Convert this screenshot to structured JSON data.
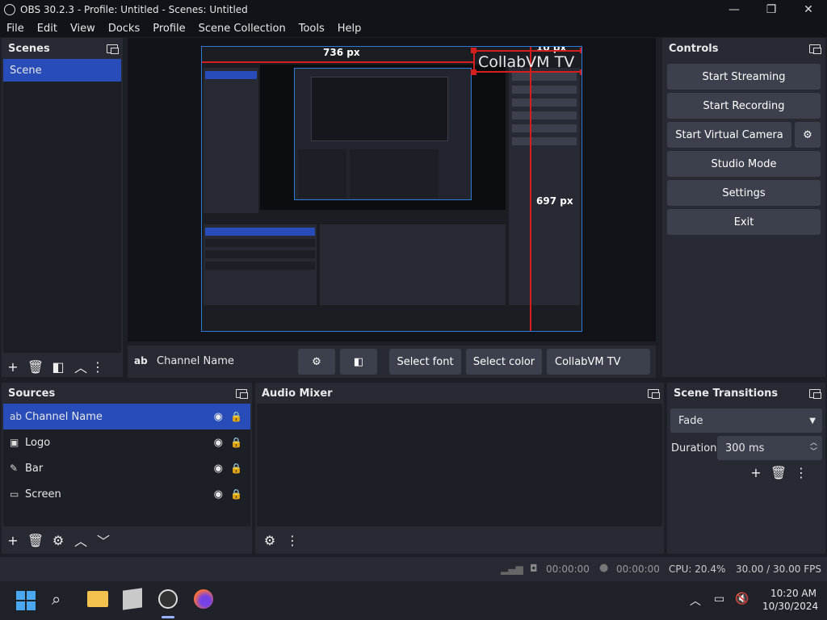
{
  "window": {
    "title": "OBS 30.2.3 - Profile: Untitled - Scenes: Untitled",
    "min": "—",
    "max": "❐",
    "close": "✕"
  },
  "menu": [
    "File",
    "Edit",
    "View",
    "Docks",
    "Profile",
    "Scene Collection",
    "Tools",
    "Help"
  ],
  "scenes": {
    "title": "Scenes",
    "items": [
      "Scene"
    ]
  },
  "controls": {
    "title": "Controls",
    "start_streaming": "Start Streaming",
    "start_recording": "Start Recording",
    "start_virtual_camera": "Start Virtual Camera",
    "studio_mode": "Studio Mode",
    "settings": "Settings",
    "exit": "Exit"
  },
  "preview": {
    "dim_top": "736 px",
    "dim_right_top": "10 px",
    "dim_right": "697 px",
    "overlay_text": "CollabVM TV",
    "border_color": "#2d7bd6",
    "guide_color": "#d41f1f"
  },
  "source_toolbar": {
    "type_icon": "ab",
    "name": "Channel Name",
    "select_font": "Select font",
    "select_color": "Select color",
    "text_value": "CollabVM TV"
  },
  "sources": {
    "title": "Sources",
    "items": [
      {
        "icon": "text-icon",
        "glyph": "ab",
        "name": "Channel Name"
      },
      {
        "icon": "image-icon",
        "glyph": "▣",
        "name": "Logo"
      },
      {
        "icon": "brush-icon",
        "glyph": "✎",
        "name": "Bar"
      },
      {
        "icon": "monitor-icon",
        "glyph": "▭",
        "name": "Screen"
      }
    ]
  },
  "audio_mixer": {
    "title": "Audio Mixer"
  },
  "transitions": {
    "title": "Scene Transitions",
    "selected": "Fade",
    "duration_label": "Duration",
    "duration_value": "300 ms"
  },
  "status": {
    "stream_time": "00:00:00",
    "rec_time": "00:00:00",
    "cpu": "CPU: 20.4%",
    "fps": "30.00 / 30.00 FPS"
  },
  "taskbar": {
    "time": "10:20 AM",
    "date": "10/30/2024"
  },
  "colors": {
    "accent": "#284cb8",
    "panel": "#272a33",
    "background": "#1d1f26"
  }
}
